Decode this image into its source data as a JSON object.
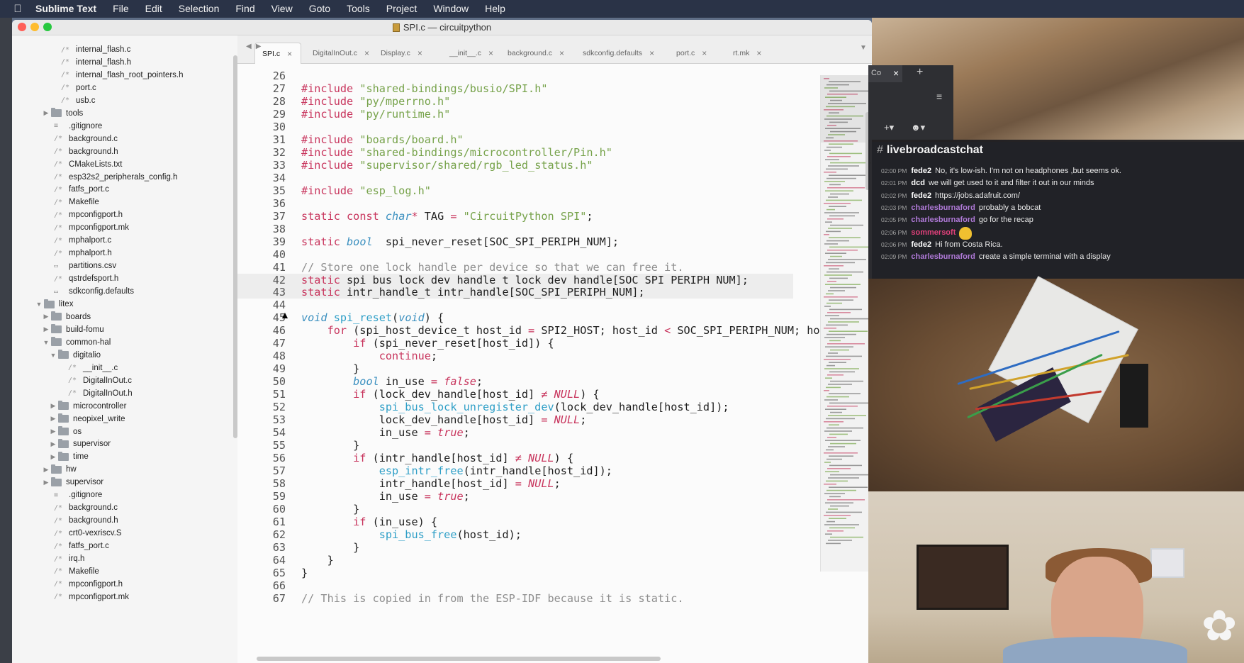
{
  "menubar": {
    "apple_icon": "apple-icon",
    "items": [
      "Sublime Text",
      "File",
      "Edit",
      "Selection",
      "Find",
      "View",
      "Goto",
      "Tools",
      "Project",
      "Window",
      "Help"
    ]
  },
  "window": {
    "title": "SPI.c — circuitpython",
    "traffic_lights": [
      "#ff5f57",
      "#febc2e",
      "#28c840"
    ]
  },
  "sidebar": {
    "items": [
      {
        "label": "internal_flash.c",
        "kind": "file"
      },
      {
        "label": "internal_flash.h",
        "kind": "file"
      },
      {
        "label": "internal_flash_root_pointers.h",
        "kind": "file"
      },
      {
        "label": "port.c",
        "kind": "file"
      },
      {
        "label": "usb.c",
        "kind": "file"
      },
      {
        "label": "tools",
        "kind": "folder-closed"
      },
      {
        "label": ".gitignore",
        "kind": "text"
      },
      {
        "label": "background.c",
        "kind": "file"
      },
      {
        "label": "background.h",
        "kind": "file"
      },
      {
        "label": "CMakeLists.txt",
        "kind": "file"
      },
      {
        "label": "esp32s2_peripherals_config.h",
        "kind": "file"
      },
      {
        "label": "fatfs_port.c",
        "kind": "file"
      },
      {
        "label": "Makefile",
        "kind": "file"
      },
      {
        "label": "mpconfigport.h",
        "kind": "file"
      },
      {
        "label": "mpconfigport.mk",
        "kind": "file"
      },
      {
        "label": "mphalport.c",
        "kind": "file"
      },
      {
        "label": "mphalport.h",
        "kind": "file"
      },
      {
        "label": "partitions.csv",
        "kind": "doc"
      },
      {
        "label": "qstrdefsport.h",
        "kind": "file"
      },
      {
        "label": "sdkconfig.defaults",
        "kind": "doc"
      },
      {
        "label": "litex",
        "kind": "folder-open"
      },
      {
        "label": "boards",
        "kind": "folder-closed"
      },
      {
        "label": "build-fomu",
        "kind": "folder-closed"
      },
      {
        "label": "common-hal",
        "kind": "folder-open"
      },
      {
        "label": "digitalio",
        "kind": "folder-open"
      },
      {
        "label": "__init__.c",
        "kind": "file"
      },
      {
        "label": "DigitalInOut.c",
        "kind": "file"
      },
      {
        "label": "DigitalInOut.h",
        "kind": "file"
      },
      {
        "label": "microcontroller",
        "kind": "folder-closed"
      },
      {
        "label": "neopixel_write",
        "kind": "folder-closed"
      },
      {
        "label": "os",
        "kind": "folder-closed"
      },
      {
        "label": "supervisor",
        "kind": "folder-closed"
      },
      {
        "label": "time",
        "kind": "folder-closed"
      },
      {
        "label": "hw",
        "kind": "folder-closed"
      },
      {
        "label": "supervisor",
        "kind": "folder-closed"
      },
      {
        "label": ".gitignore",
        "kind": "text"
      },
      {
        "label": "background.c",
        "kind": "file"
      },
      {
        "label": "background.h",
        "kind": "file"
      },
      {
        "label": "crt0-vexriscv.S",
        "kind": "file"
      },
      {
        "label": "fatfs_port.c",
        "kind": "file"
      },
      {
        "label": "irq.h",
        "kind": "file"
      },
      {
        "label": "Makefile",
        "kind": "file"
      },
      {
        "label": "mpconfigport.h",
        "kind": "file"
      },
      {
        "label": "mpconfigport.mk",
        "kind": "file"
      }
    ]
  },
  "tabs": [
    {
      "label": "SPI.c",
      "active": true
    },
    {
      "label": "DigitalInOut.c",
      "active": false
    },
    {
      "label": "Display.c",
      "active": false
    },
    {
      "label": "__init__.c",
      "active": false
    },
    {
      "label": "background.c",
      "active": false
    },
    {
      "label": "sdkconfig.defaults",
      "active": false
    },
    {
      "label": "port.c",
      "active": false
    },
    {
      "label": "rt.mk",
      "active": false
    }
  ],
  "editor": {
    "highlighted_lines": [
      42,
      43
    ],
    "lines": [
      {
        "n": "26",
        "tokens": []
      },
      {
        "n": "27",
        "tokens": [
          [
            "k",
            "#include"
          ],
          [
            "p",
            " "
          ],
          [
            "s",
            "\"shared-bindings/busio/SPI.h\""
          ]
        ]
      },
      {
        "n": "28",
        "tokens": [
          [
            "k",
            "#include"
          ],
          [
            "p",
            " "
          ],
          [
            "s",
            "\"py/mperrno.h\""
          ]
        ]
      },
      {
        "n": "29",
        "tokens": [
          [
            "k",
            "#include"
          ],
          [
            "p",
            " "
          ],
          [
            "s",
            "\"py/runtime.h\""
          ]
        ]
      },
      {
        "n": "30",
        "tokens": []
      },
      {
        "n": "31",
        "tokens": [
          [
            "k",
            "#include"
          ],
          [
            "p",
            " "
          ],
          [
            "s",
            "\"boards/board.h\""
          ]
        ]
      },
      {
        "n": "32",
        "tokens": [
          [
            "k",
            "#include"
          ],
          [
            "p",
            " "
          ],
          [
            "s",
            "\"shared-bindings/microcontroller/Pin.h\""
          ]
        ]
      },
      {
        "n": "33",
        "tokens": [
          [
            "k",
            "#include"
          ],
          [
            "p",
            " "
          ],
          [
            "s",
            "\"supervisor/shared/rgb_led_status.h\""
          ]
        ]
      },
      {
        "n": "34",
        "tokens": []
      },
      {
        "n": "35",
        "tokens": [
          [
            "k",
            "#include"
          ],
          [
            "p",
            " "
          ],
          [
            "s",
            "\"esp_log.h\""
          ]
        ]
      },
      {
        "n": "36",
        "tokens": []
      },
      {
        "n": "37",
        "tokens": [
          [
            "k",
            "static"
          ],
          [
            "p",
            " "
          ],
          [
            "k",
            "const"
          ],
          [
            "p",
            " "
          ],
          [
            "t",
            "char"
          ],
          [
            "k",
            "*"
          ],
          [
            "p",
            " TAG "
          ],
          [
            "k",
            "="
          ],
          [
            "p",
            " "
          ],
          [
            "s",
            "\"CircuitPython SPI\""
          ],
          [
            "p",
            ";"
          ]
        ]
      },
      {
        "n": "38",
        "tokens": []
      },
      {
        "n": "39",
        "tokens": [
          [
            "k",
            "static"
          ],
          [
            "p",
            " "
          ],
          [
            "t",
            "bool"
          ],
          [
            "p",
            "  spi_never_reset[SOC_SPI_PERIPH_NUM];"
          ]
        ]
      },
      {
        "n": "40",
        "tokens": []
      },
      {
        "n": "41",
        "tokens": [
          [
            "c",
            "// Store one lock handle per device so that we can free it."
          ]
        ]
      },
      {
        "n": "42",
        "tokens": [
          [
            "k",
            "static"
          ],
          [
            "p",
            " spi_bus_lock_dev_handle_t lock_dev_handle[SOC_SPI_PERIPH_NUM];"
          ]
        ]
      },
      {
        "n": "43",
        "tokens": [
          [
            "k",
            "static"
          ],
          [
            "p",
            " intr_handle_t intr_handle[SOC_SPI_PERIPH_NUM];"
          ]
        ]
      },
      {
        "n": "44",
        "tokens": []
      },
      {
        "n": "45",
        "tokens": [
          [
            "t",
            "void"
          ],
          [
            "p",
            " "
          ],
          [
            "f",
            "spi_reset"
          ],
          [
            "p",
            "("
          ],
          [
            "t",
            "void"
          ],
          [
            "p",
            ") {"
          ]
        ]
      },
      {
        "n": "46",
        "tokens": [
          [
            "p",
            "    "
          ],
          [
            "k",
            "for"
          ],
          [
            "p",
            " (spi_host_device_t host_id "
          ],
          [
            "k",
            "="
          ],
          [
            "p",
            " SPI2_HOST; host_id "
          ],
          [
            "k",
            "<"
          ],
          [
            "p",
            " SOC_SPI_PERIPH_NUM; host_id"
          ],
          [
            "k",
            "++"
          ],
          [
            "p",
            ") {"
          ]
        ]
      },
      {
        "n": "47",
        "tokens": [
          [
            "p",
            "        "
          ],
          [
            "k",
            "if"
          ],
          [
            "p",
            " (spi_never_reset[host_id]) {"
          ]
        ]
      },
      {
        "n": "48",
        "tokens": [
          [
            "p",
            "            "
          ],
          [
            "k",
            "continue"
          ],
          [
            "p",
            ";"
          ]
        ]
      },
      {
        "n": "49",
        "tokens": [
          [
            "p",
            "        }"
          ]
        ]
      },
      {
        "n": "50",
        "tokens": [
          [
            "p",
            "        "
          ],
          [
            "t",
            "bool"
          ],
          [
            "p",
            " in_use "
          ],
          [
            "k",
            "="
          ],
          [
            "p",
            " "
          ],
          [
            "v",
            "false"
          ],
          [
            "p",
            ";"
          ]
        ]
      },
      {
        "n": "51",
        "tokens": [
          [
            "p",
            "        "
          ],
          [
            "k",
            "if"
          ],
          [
            "p",
            " (lock_dev_handle[host_id] "
          ],
          [
            "k",
            "≠"
          ],
          [
            "p",
            " "
          ],
          [
            "v",
            "NULL"
          ],
          [
            "p",
            ") {"
          ]
        ]
      },
      {
        "n": "52",
        "tokens": [
          [
            "p",
            "            "
          ],
          [
            "f",
            "spi_bus_lock_unregister_dev"
          ],
          [
            "p",
            "(lock_dev_handle[host_id]);"
          ]
        ]
      },
      {
        "n": "53",
        "tokens": [
          [
            "p",
            "            lock_dev_handle[host_id] "
          ],
          [
            "k",
            "="
          ],
          [
            "p",
            " "
          ],
          [
            "v",
            "NULL"
          ],
          [
            "p",
            ";"
          ]
        ]
      },
      {
        "n": "54",
        "tokens": [
          [
            "p",
            "            in_use "
          ],
          [
            "k",
            "="
          ],
          [
            "p",
            " "
          ],
          [
            "v",
            "true"
          ],
          [
            "p",
            ";"
          ]
        ]
      },
      {
        "n": "55",
        "tokens": [
          [
            "p",
            "        }"
          ]
        ]
      },
      {
        "n": "56",
        "tokens": [
          [
            "p",
            "        "
          ],
          [
            "k",
            "if"
          ],
          [
            "p",
            " (intr_handle[host_id] "
          ],
          [
            "k",
            "≠"
          ],
          [
            "p",
            " "
          ],
          [
            "v",
            "NULL"
          ],
          [
            "p",
            ") {"
          ]
        ]
      },
      {
        "n": "57",
        "tokens": [
          [
            "p",
            "            "
          ],
          [
            "f",
            "esp_intr_free"
          ],
          [
            "p",
            "(intr_handle[host_id]);"
          ]
        ]
      },
      {
        "n": "58",
        "tokens": [
          [
            "p",
            "            intr_handle[host_id] "
          ],
          [
            "k",
            "="
          ],
          [
            "p",
            " "
          ],
          [
            "v",
            "NULL"
          ],
          [
            "p",
            ";"
          ]
        ]
      },
      {
        "n": "59",
        "tokens": [
          [
            "p",
            "            in_use "
          ],
          [
            "k",
            "="
          ],
          [
            "p",
            " "
          ],
          [
            "v",
            "true"
          ],
          [
            "p",
            ";"
          ]
        ]
      },
      {
        "n": "60",
        "tokens": [
          [
            "p",
            "        }"
          ]
        ]
      },
      {
        "n": "61",
        "tokens": [
          [
            "p",
            "        "
          ],
          [
            "k",
            "if"
          ],
          [
            "p",
            " (in_use) {"
          ]
        ]
      },
      {
        "n": "62",
        "tokens": [
          [
            "p",
            "            "
          ],
          [
            "f",
            "spi_bus_free"
          ],
          [
            "p",
            "(host_id);"
          ]
        ]
      },
      {
        "n": "63",
        "tokens": [
          [
            "p",
            "        }"
          ]
        ]
      },
      {
        "n": "64",
        "tokens": [
          [
            "p",
            "    }"
          ]
        ]
      },
      {
        "n": "65",
        "tokens": [
          [
            "p",
            "}"
          ]
        ]
      },
      {
        "n": "66",
        "tokens": []
      },
      {
        "n": "67",
        "tokens": [
          [
            "c",
            "// This is copied in from the ESP-IDF because it is static."
          ]
        ]
      }
    ]
  },
  "browser": {
    "tab_label": "Co",
    "close_icon": "×",
    "new_tab_icon": "+",
    "menu_icon": "≡",
    "add_icon": "+▾",
    "status_icon": "☻▾"
  },
  "chat": {
    "channel_hash": "#",
    "channel": "livebroadcastchat",
    "messages": [
      {
        "time": "02:00 PM",
        "user": "fede2",
        "color": "#ffffff",
        "text": "No, it's low-ish. I'm not on headphones ,but seems ok."
      },
      {
        "time": "02:01 PM",
        "user": "dcd",
        "color": "#ffffff",
        "text": "we will get used to it and filter it out in our minds"
      },
      {
        "time": "02:02 PM",
        "user": "fede2",
        "color": "#ffffff",
        "text": "https://jobs.adafruit.com/"
      },
      {
        "time": "02:03 PM",
        "user": "charlesburnaford",
        "color": "#b07ad8",
        "text": "probably a bobcat"
      },
      {
        "time": "02:05 PM",
        "user": "charlesburnaford",
        "color": "#b07ad8",
        "text": "go for the recap"
      },
      {
        "time": "02:06 PM",
        "user": "sommersoft",
        "color": "#e0407a",
        "text": "",
        "emoji": "waving-hand-emoji"
      },
      {
        "time": "02:06 PM",
        "user": "fede2",
        "color": "#ffffff",
        "text": "Hi from Costa Rica."
      },
      {
        "time": "02:09 PM",
        "user": "charlesburnaford",
        "color": "#b07ad8",
        "text": "create a simple terminal with a display"
      }
    ]
  },
  "stream": {
    "logo": "✿"
  }
}
